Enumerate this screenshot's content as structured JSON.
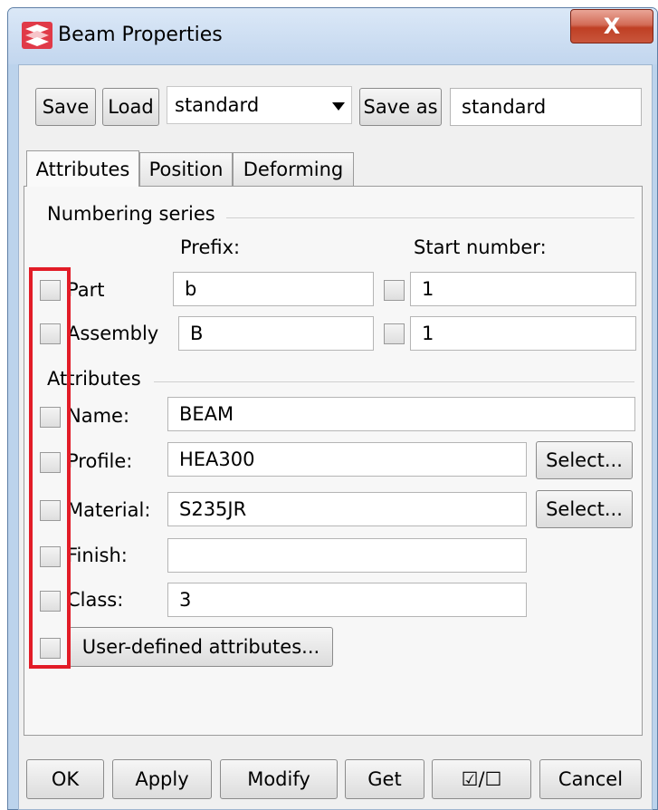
{
  "window": {
    "title": "Beam Properties",
    "close_glyph": "X"
  },
  "toolbar": {
    "save_label": "Save",
    "load_label": "Load",
    "preset_value": "standard",
    "save_as_label": "Save as",
    "save_as_value": "standard"
  },
  "tabs": [
    "Attributes",
    "Position",
    "Deforming"
  ],
  "numbering": {
    "title": "Numbering series",
    "prefix_header": "Prefix:",
    "start_header": "Start number:",
    "rows": [
      {
        "label": "Part",
        "prefix": "b",
        "start": "1"
      },
      {
        "label": "Assembly",
        "prefix": "B",
        "start": "1"
      }
    ]
  },
  "attributes": {
    "title": "Attributes",
    "rows": [
      {
        "label": "Name:",
        "value": "BEAM"
      },
      {
        "label": "Profile:",
        "value": "HEA300"
      },
      {
        "label": "Material:",
        "value": "S235JR"
      },
      {
        "label": "Finish:",
        "value": ""
      },
      {
        "label": "Class:",
        "value": "3"
      }
    ],
    "select_label": "Select...",
    "user_defined_label": "User-defined attributes..."
  },
  "footer": {
    "ok": "OK",
    "apply": "Apply",
    "modify": "Modify",
    "get": "Get",
    "toggle_all": "☑/☐",
    "cancel": "Cancel"
  },
  "colors": {
    "highlight": "#e21c27",
    "close_button": "#c9503a",
    "title_bar": "#c9dbf0"
  }
}
